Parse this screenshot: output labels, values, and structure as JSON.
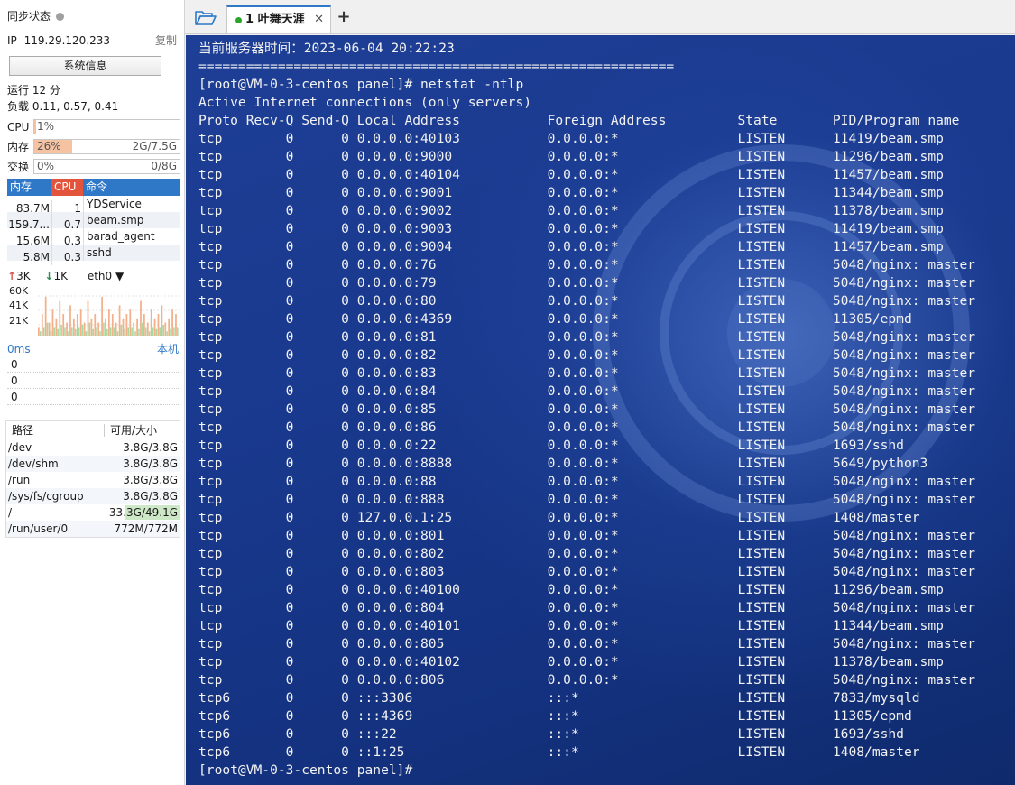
{
  "sidebar": {
    "sync_status": "同步状态",
    "ip_label": "IP",
    "ip": "119.29.120.233",
    "copy": "复制",
    "sysinfo_button": "系统信息",
    "uptime": "运行 12 分",
    "load": "负载 0.11, 0.57, 0.41",
    "cpu": {
      "label": "CPU",
      "text": "1%",
      "percent": 1
    },
    "mem": {
      "label": "内存",
      "text": "26%",
      "percent": 26,
      "size": "2G/7.5G"
    },
    "swap": {
      "label": "交换",
      "text": "0%",
      "percent": 0,
      "size": "0/8G"
    },
    "proc_headers": {
      "mem": "内存",
      "cpu": "CPU",
      "cmd": "命令"
    },
    "processes": [
      {
        "mem": "83.7M",
        "cpu": "1",
        "cmd": "YDService"
      },
      {
        "mem": "159.7...",
        "cpu": "0.7",
        "cmd": "beam.smp"
      },
      {
        "mem": "15.6M",
        "cpu": "0.3",
        "cmd": "barad_agent"
      },
      {
        "mem": "5.8M",
        "cpu": "0.3",
        "cmd": "sshd"
      }
    ],
    "net": {
      "up": "3K",
      "down": "1K",
      "iface": "eth0",
      "ticks": [
        "60K",
        "41K",
        "21K"
      ],
      "bars_up": [
        0.2,
        0.5,
        0.9,
        0.3,
        0.6,
        0.4,
        0.8,
        0.5,
        0.3,
        0.7,
        0.4,
        0.5,
        0.6,
        0.3,
        0.8,
        0.4,
        0.5,
        0.3,
        0.9,
        0.4,
        0.6,
        0.5,
        0.3,
        0.7,
        0.4,
        0.5,
        0.6,
        0.3,
        0.4,
        0.8,
        0.5,
        0.3,
        0.6,
        0.4,
        0.5,
        0.7,
        0.3,
        0.4,
        0.6,
        0.5
      ],
      "bars_down": [
        0.1,
        0.2,
        0.3,
        0.1,
        0.2,
        0.15,
        0.25,
        0.2,
        0.1,
        0.2,
        0.15,
        0.2,
        0.25,
        0.1,
        0.3,
        0.15,
        0.2,
        0.1,
        0.3,
        0.15,
        0.2,
        0.2,
        0.1,
        0.25,
        0.15,
        0.2,
        0.2,
        0.1,
        0.15,
        0.3,
        0.2,
        0.1,
        0.2,
        0.15,
        0.2,
        0.25,
        0.1,
        0.15,
        0.2,
        0.2
      ]
    },
    "latency": {
      "ms": "0ms",
      "local": "本机",
      "values": [
        "0",
        "0",
        "0"
      ]
    },
    "disk_headers": {
      "path": "路径",
      "size": "可用/大小"
    },
    "disks": [
      {
        "path": "/dev",
        "size": "3.8G/3.8G",
        "used": 0.0
      },
      {
        "path": "/dev/shm",
        "size": "3.8G/3.8G",
        "used": 0.0
      },
      {
        "path": "/run",
        "size": "3.8G/3.8G",
        "used": 0.0
      },
      {
        "path": "/sys/fs/cgroup",
        "size": "3.8G/3.8G",
        "used": 0.0
      },
      {
        "path": "/",
        "size": "33.3G/49.1G",
        "used": 0.32
      },
      {
        "path": "/run/user/0",
        "size": "772M/772M",
        "used": 0.0
      }
    ]
  },
  "tabs": [
    {
      "label": "1 叶舞天涯",
      "close": "✕"
    }
  ],
  "new_tab": "+",
  "terminal": {
    "lines": [
      "当前服务器时间：2023-06-04 20:22:23",
      "============================================================",
      "[root@VM-0-3-centos panel]# netstat -ntlp",
      "Active Internet connections (only servers)",
      "Proto Recv-Q Send-Q Local Address           Foreign Address         State       PID/Program name",
      "tcp        0      0 0.0.0.0:40103           0.0.0.0:*               LISTEN      11419/beam.smp",
      "tcp        0      0 0.0.0.0:9000            0.0.0.0:*               LISTEN      11296/beam.smp",
      "tcp        0      0 0.0.0.0:40104           0.0.0.0:*               LISTEN      11457/beam.smp",
      "tcp        0      0 0.0.0.0:9001            0.0.0.0:*               LISTEN      11344/beam.smp",
      "tcp        0      0 0.0.0.0:9002            0.0.0.0:*               LISTEN      11378/beam.smp",
      "tcp        0      0 0.0.0.0:9003            0.0.0.0:*               LISTEN      11419/beam.smp",
      "tcp        0      0 0.0.0.0:9004            0.0.0.0:*               LISTEN      11457/beam.smp",
      "tcp        0      0 0.0.0.0:76              0.0.0.0:*               LISTEN      5048/nginx: master",
      "tcp        0      0 0.0.0.0:79              0.0.0.0:*               LISTEN      5048/nginx: master",
      "tcp        0      0 0.0.0.0:80              0.0.0.0:*               LISTEN      5048/nginx: master",
      "tcp        0      0 0.0.0.0:4369            0.0.0.0:*               LISTEN      11305/epmd",
      "tcp        0      0 0.0.0.0:81              0.0.0.0:*               LISTEN      5048/nginx: master",
      "tcp        0      0 0.0.0.0:82              0.0.0.0:*               LISTEN      5048/nginx: master",
      "tcp        0      0 0.0.0.0:83              0.0.0.0:*               LISTEN      5048/nginx: master",
      "tcp        0      0 0.0.0.0:84              0.0.0.0:*               LISTEN      5048/nginx: master",
      "tcp        0      0 0.0.0.0:85              0.0.0.0:*               LISTEN      5048/nginx: master",
      "tcp        0      0 0.0.0.0:86              0.0.0.0:*               LISTEN      5048/nginx: master",
      "tcp        0      0 0.0.0.0:22              0.0.0.0:*               LISTEN      1693/sshd",
      "tcp        0      0 0.0.0.0:8888            0.0.0.0:*               LISTEN      5649/python3",
      "tcp        0      0 0.0.0.0:88              0.0.0.0:*               LISTEN      5048/nginx: master",
      "tcp        0      0 0.0.0.0:888             0.0.0.0:*               LISTEN      5048/nginx: master",
      "tcp        0      0 127.0.0.1:25            0.0.0.0:*               LISTEN      1408/master",
      "tcp        0      0 0.0.0.0:801             0.0.0.0:*               LISTEN      5048/nginx: master",
      "tcp        0      0 0.0.0.0:802             0.0.0.0:*               LISTEN      5048/nginx: master",
      "tcp        0      0 0.0.0.0:803             0.0.0.0:*               LISTEN      5048/nginx: master",
      "tcp        0      0 0.0.0.0:40100           0.0.0.0:*               LISTEN      11296/beam.smp",
      "tcp        0      0 0.0.0.0:804             0.0.0.0:*               LISTEN      5048/nginx: master",
      "tcp        0      0 0.0.0.0:40101           0.0.0.0:*               LISTEN      11344/beam.smp",
      "tcp        0      0 0.0.0.0:805             0.0.0.0:*               LISTEN      5048/nginx: master",
      "tcp        0      0 0.0.0.0:40102           0.0.0.0:*               LISTEN      11378/beam.smp",
      "tcp        0      0 0.0.0.0:806             0.0.0.0:*               LISTEN      5048/nginx: master",
      "tcp6       0      0 :::3306                 :::*                    LISTEN      7833/mysqld",
      "tcp6       0      0 :::4369                 :::*                    LISTEN      11305/epmd",
      "tcp6       0      0 :::22                   :::*                    LISTEN      1693/sshd",
      "tcp6       0      0 ::1:25                  :::*                    LISTEN      1408/master",
      "[root@VM-0-3-centos panel]#"
    ]
  },
  "colors": {
    "accent": "#2f78c8",
    "cpu_header": "#e2553c",
    "terminal_text": "#f2f2f2",
    "terminal_bg": "#19398e"
  }
}
